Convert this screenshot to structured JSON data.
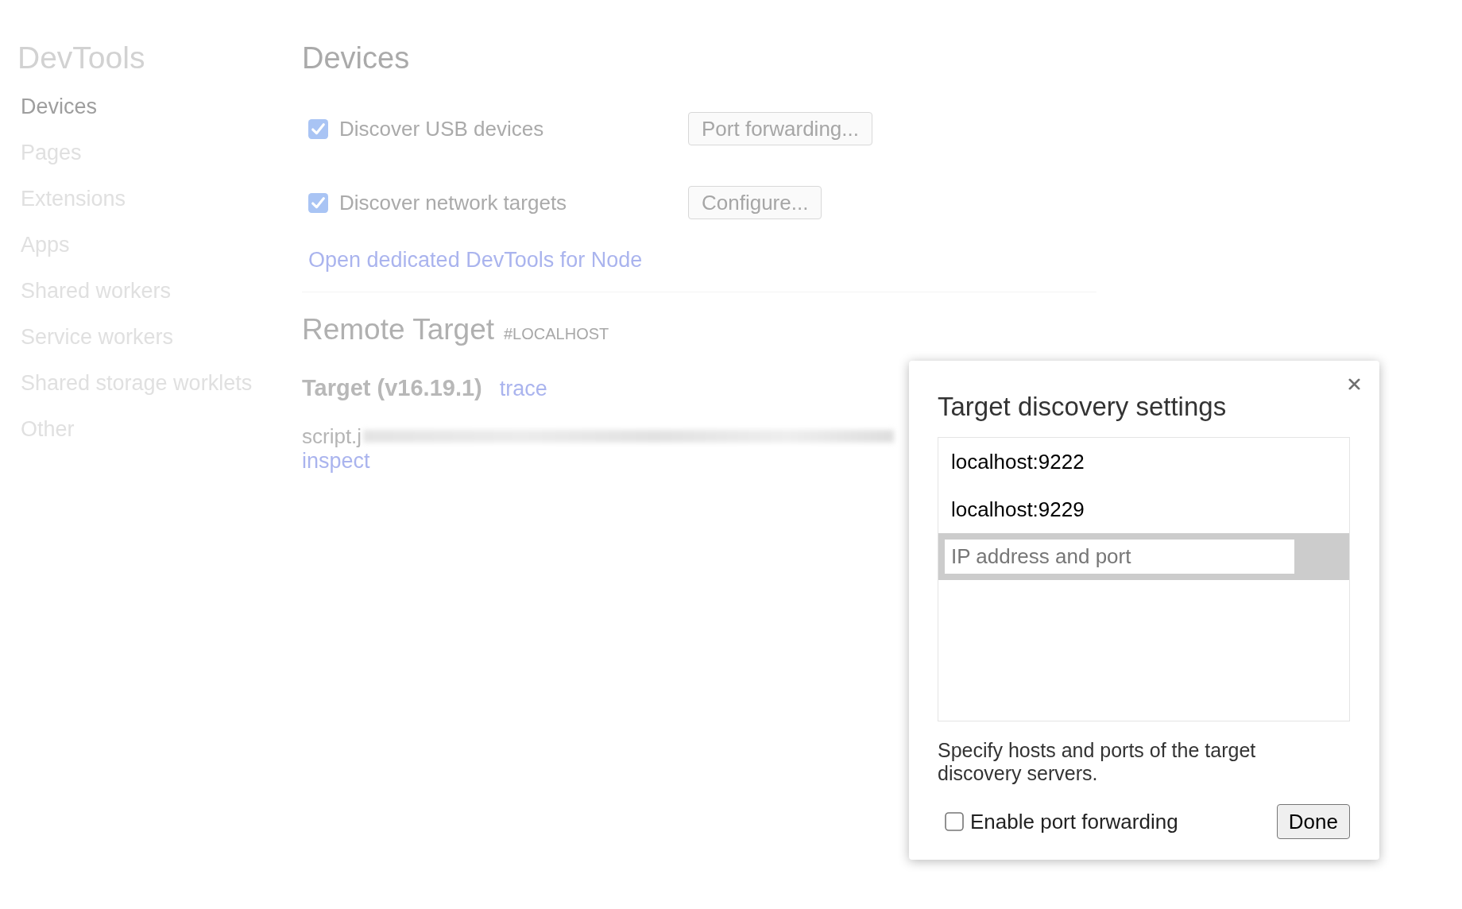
{
  "sidebar": {
    "title": "DevTools",
    "items": [
      {
        "label": "Devices",
        "selected": true
      },
      {
        "label": "Pages",
        "selected": false
      },
      {
        "label": "Extensions",
        "selected": false
      },
      {
        "label": "Apps",
        "selected": false
      },
      {
        "label": "Shared workers",
        "selected": false
      },
      {
        "label": "Service workers",
        "selected": false
      },
      {
        "label": "Shared storage worklets",
        "selected": false
      },
      {
        "label": "Other",
        "selected": false
      }
    ]
  },
  "main": {
    "title": "Devices",
    "options": [
      {
        "label": "Discover USB devices",
        "checked": true,
        "button": "Port forwarding..."
      },
      {
        "label": "Discover network targets",
        "checked": true,
        "button": "Configure..."
      }
    ],
    "node_link": "Open dedicated DevTools for Node",
    "remote_target": {
      "title": "Remote Target",
      "tag": "#LOCALHOST",
      "target_name": "Target (v16.19.1)",
      "trace_link": "trace",
      "script": "script.j",
      "inspect_link": "inspect"
    }
  },
  "dialog": {
    "title": "Target discovery settings",
    "hosts": [
      "localhost:9222",
      "localhost:9229"
    ],
    "new_host": {
      "placeholder": "IP address and port"
    },
    "description": "Specify hosts and ports of the target discovery servers.",
    "port_forwarding": {
      "label": "Enable port forwarding",
      "checked": false
    },
    "done_button": "Done"
  }
}
